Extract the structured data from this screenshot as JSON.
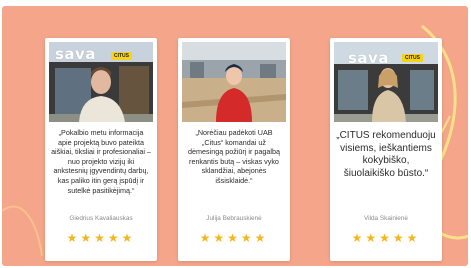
{
  "colors": {
    "background": "#f4a58a",
    "card": "#ffffff",
    "star": "#f3b61f",
    "swirl": "#fbe08a"
  },
  "testimonials": [
    {
      "photo_logo": "sava",
      "photo_tag": "CITUS",
      "quote": "„Pokalbio metu informacija apie projektą buvo pateikta aiškiai, tiksliai ir profesionaliai – nuo projekto vizijų iki ankstesnių įgyvendintų darbų, kas paliko itin gerą įspūdį ir sutelkė pasitikėjimą.“",
      "author": "Giedrius Kavaliauskas",
      "stars": "★★★★★"
    },
    {
      "photo_logo": "",
      "photo_tag": "",
      "quote": "„Norėčiau padėkoti UAB „Citus“ komandai už dėmesingą požiūrį ir pagalbą renkantis butą – viskas vyko sklandžiai, abejonės išsisklaidė.“",
      "author": "Julija Bebrauskienė",
      "stars": "★★★★★"
    },
    {
      "photo_logo": "sava",
      "photo_tag": "CITUS",
      "quote": "„CITUS rekomenduoju visiems, ieškantiems kokybiško, šiuolaikiško būsto.“",
      "author": "Vilda Skainienė",
      "stars": "★★★★★"
    }
  ]
}
